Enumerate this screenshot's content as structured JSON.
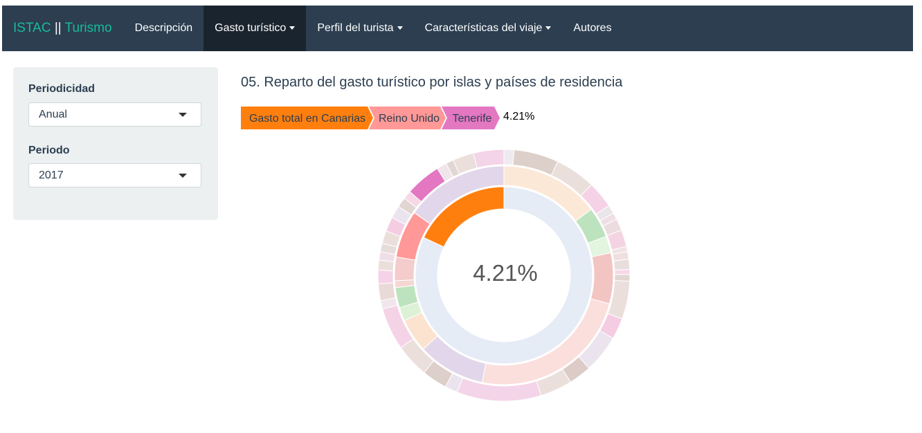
{
  "navbar": {
    "brand_left": "ISTAC",
    "brand_sep": " || ",
    "brand_right": "Turismo",
    "items": [
      {
        "label": "Descripción",
        "dropdown": false,
        "active": false
      },
      {
        "label": "Gasto turístico",
        "dropdown": true,
        "active": true
      },
      {
        "label": "Perfil del turista",
        "dropdown": true,
        "active": false
      },
      {
        "label": "Características del viaje",
        "dropdown": true,
        "active": false
      },
      {
        "label": "Autores",
        "dropdown": false,
        "active": false
      }
    ]
  },
  "sidebar": {
    "periodicidad_label": "Periodicidad",
    "periodicidad_value": "Anual",
    "periodo_label": "Periodo",
    "periodo_value": "2017"
  },
  "main": {
    "title": "05. Reparto del gasto turístico por islas y países de residencia",
    "breadcrumb": [
      {
        "label": "Gasto total en Canarias",
        "color": "#ff7f0e"
      },
      {
        "label": "Reino Unido",
        "color": "#ff9896"
      },
      {
        "label": "Tenerife",
        "color": "#e377c2"
      }
    ],
    "percentage": "4.21%"
  },
  "chart_data": {
    "type": "sunburst",
    "center_label": "4.21%",
    "highlighted_path": [
      "Gasto total en Canarias",
      "Reino Unido",
      "Tenerife"
    ],
    "colors": {
      "root": "#ff7f0e",
      "root_faded": "#e6ecf6",
      "highlight_country": "#ff9896",
      "highlight_island": "#e377c2"
    },
    "rings": [
      {
        "level": "root",
        "segments": [
          {
            "name": "Gasto total en Canarias",
            "share": 0.18,
            "color": "#ff7f0e",
            "highlighted": true
          },
          {
            "name": "",
            "share": 0.82,
            "color": "#e6ecf6",
            "highlighted": false
          }
        ]
      },
      {
        "level": "countries",
        "segments": [
          {
            "share": 0.147,
            "color": "#fce8d6"
          },
          {
            "share": 0.045,
            "color": "#bde3be"
          },
          {
            "share": 0.025,
            "color": "#e3f4df"
          },
          {
            "share": 0.075,
            "color": "#f2c4c2"
          },
          {
            "share": 0.24,
            "color": "#fbdfdd"
          },
          {
            "share": 0.1,
            "color": "#e2d7ea"
          },
          {
            "share": 0.05,
            "color": "#fbe3cf"
          },
          {
            "share": 0.02,
            "color": "#dcf1d6"
          },
          {
            "share": 0.03,
            "color": "#bde3be"
          },
          {
            "share": 0.01,
            "color": "#f6d6d3"
          },
          {
            "share": 0.035,
            "color": "#f3cccb"
          },
          {
            "name": "Reino Unido",
            "share": 0.07,
            "color": "#ff9896",
            "highlighted": true
          },
          {
            "share": 0.153,
            "color": "#e2d7ea"
          }
        ]
      },
      {
        "level": "islands",
        "segments": [
          {
            "share": 0.012,
            "color": "#efeaf0"
          },
          {
            "share": 0.053,
            "color": "#ddcfc9"
          },
          {
            "share": 0.048,
            "color": "#ebdfdc"
          },
          {
            "share": 0.032,
            "color": "#f6d2e6"
          },
          {
            "share": 0.01,
            "color": "#e8e6e8"
          },
          {
            "share": 0.008,
            "color": "#efdfe5"
          },
          {
            "share": 0.014,
            "color": "#ecdcdf"
          },
          {
            "share": 0.02,
            "color": "#f4d4e2"
          },
          {
            "share": 0.006,
            "color": "#f1e2e4"
          },
          {
            "share": 0.009,
            "color": "#eedfe0"
          },
          {
            "share": 0.012,
            "color": "#e8dede"
          },
          {
            "share": 0.006,
            "color": "#f6d8e6"
          },
          {
            "share": 0.008,
            "color": "#e2d6d3"
          },
          {
            "share": 0.045,
            "color": "#ebdfdc"
          },
          {
            "share": 0.025,
            "color": "#f4cde3"
          },
          {
            "share": 0.045,
            "color": "#ebe4ee"
          },
          {
            "share": 0.027,
            "color": "#dccbc6"
          },
          {
            "share": 0.038,
            "color": "#ebdfdc"
          },
          {
            "share": 0.1,
            "color": "#f4d4e8"
          },
          {
            "share": 0.015,
            "color": "#ebe4ee"
          },
          {
            "share": 0.03,
            "color": "#ddcfc9"
          },
          {
            "share": 0.04,
            "color": "#ebdfdc"
          },
          {
            "share": 0.05,
            "color": "#f5d3e6"
          },
          {
            "share": 0.01,
            "color": "#efe5ea"
          },
          {
            "share": 0.02,
            "color": "#eadad7"
          },
          {
            "share": 0.016,
            "color": "#f6d2e6"
          },
          {
            "share": 0.012,
            "color": "#ebdfdc"
          },
          {
            "share": 0.01,
            "color": "#f1dfe8"
          },
          {
            "share": 0.01,
            "color": "#e6dcda"
          },
          {
            "share": 0.015,
            "color": "#ebdfdc"
          },
          {
            "share": 0.017,
            "color": "#f4cde3"
          },
          {
            "share": 0.015,
            "color": "#ebe4ee"
          },
          {
            "share": 0.012,
            "color": "#e2d6d3"
          },
          {
            "share": 0.01,
            "color": "#f6d8e6"
          },
          {
            "name": "Tenerife",
            "share": 0.042,
            "color": "#e377c2",
            "highlighted": true
          },
          {
            "share": 0.012,
            "color": "#efe5ea"
          },
          {
            "share": 0.009,
            "color": "#e2d6d3"
          },
          {
            "share": 0.025,
            "color": "#ebdfdc"
          },
          {
            "share": 0.036,
            "color": "#f4d4e8"
          }
        ]
      }
    ]
  }
}
